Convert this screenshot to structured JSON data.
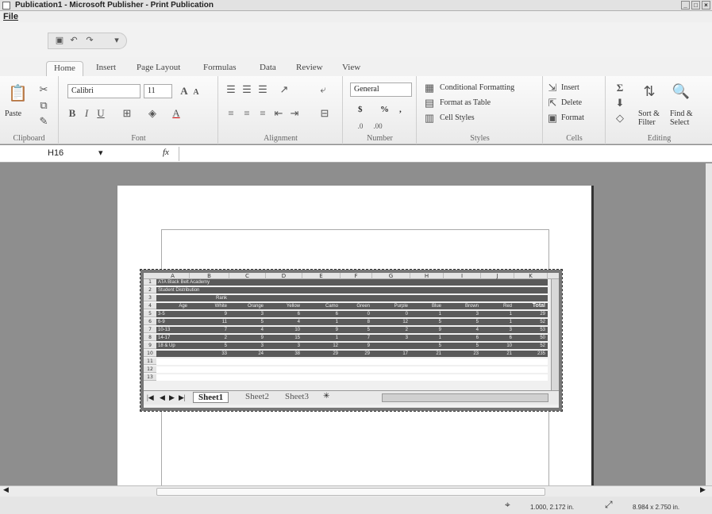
{
  "window": {
    "title": "Publication1 - Microsoft Publisher - Print Publication"
  },
  "menu": {
    "file": "File"
  },
  "tabs": [
    "Home",
    "Insert",
    "Page Layout",
    "Formulas",
    "Data",
    "Review",
    "View"
  ],
  "clipboard": {
    "paste": "Paste",
    "label": "Clipboard"
  },
  "font": {
    "name": "Calibri",
    "size": "11",
    "label": "Font"
  },
  "alignment": {
    "label": "Alignment"
  },
  "number": {
    "format": "General",
    "currency": "$",
    "percent": "%",
    "comma": ",",
    "label": "Number"
  },
  "styles": {
    "conditional": "Conditional Formatting",
    "table": "Format as Table",
    "cell": "Cell Styles",
    "label": "Styles"
  },
  "cells": {
    "insert": "Insert",
    "delete": "Delete",
    "format": "Format",
    "label": "Cells"
  },
  "editing": {
    "sort": "Sort &",
    "sort2": "Filter",
    "find": "Find &",
    "find2": "Select",
    "label": "Editing"
  },
  "formula_bar": {
    "cell_ref": "H16",
    "fx": "fx"
  },
  "sheet": {
    "columns": [
      "A",
      "B",
      "C",
      "D",
      "E",
      "F",
      "G",
      "H",
      "I",
      "J",
      "K"
    ],
    "row_numbers": [
      "1",
      "2",
      "3",
      "4",
      "5",
      "6",
      "7",
      "8",
      "9",
      "10",
      "11",
      "12",
      "13"
    ],
    "title": "ATA Black Belt Academy",
    "subtitle": "Student Distribution",
    "rank": "Rank",
    "headers": [
      "Age",
      "White",
      "Orange",
      "Yellow",
      "Camo",
      "Green",
      "Purple",
      "Blue",
      "Brown",
      "Red",
      "Total"
    ],
    "rows": [
      [
        "3-5",
        "9",
        "3",
        "6",
        "6",
        "0",
        "0",
        "1",
        "3",
        "1",
        "29"
      ],
      [
        "6-9",
        "11",
        "5",
        "4",
        "1",
        "8",
        "12",
        "5",
        "5",
        "1",
        "52"
      ],
      [
        "10-13",
        "7",
        "4",
        "10",
        "9",
        "5",
        "2",
        "9",
        "4",
        "3",
        "53"
      ],
      [
        "14-17",
        "2",
        "9",
        "15",
        "1",
        "7",
        "3",
        "1",
        "6",
        "6",
        "50"
      ],
      [
        "18 & Up",
        "5",
        "3",
        "3",
        "12",
        "9",
        "",
        "5",
        "5",
        "10",
        "52"
      ],
      [
        "",
        "33",
        "24",
        "38",
        "29",
        "29",
        "17",
        "21",
        "23",
        "21",
        "235"
      ]
    ],
    "tabs": [
      "Sheet1",
      "Sheet2",
      "Sheet3"
    ]
  },
  "status": {
    "position": "1.000, 2.172 in.",
    "size": "8.984 x 2.750 in."
  }
}
